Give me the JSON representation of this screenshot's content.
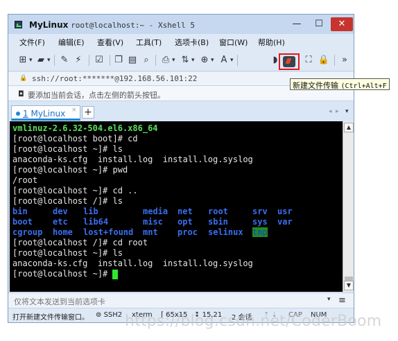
{
  "window": {
    "title_app": "MyLinux",
    "title_rest": "root@localhost:~ - Xshell 5",
    "min_glyph": "—",
    "max_glyph": "☐",
    "close_glyph": "✕"
  },
  "menu": [
    "文件(F)",
    "编辑(E)",
    "查看(V)",
    "工具(T)",
    "选项卡(B)",
    "窗口(W)",
    "帮助(H)"
  ],
  "toolbar": {
    "tooltip_label": "新建文件传输",
    "tooltip_shortcut": "(Ctrl+Alt+F",
    "overflow_glyph": "»"
  },
  "address": {
    "text": "ssh://root:*******@192.168.56.101:22"
  },
  "hint": {
    "text": "要添加当前会话，点击左侧的箭头按钮。"
  },
  "tab": {
    "number": "1",
    "label": "MyLinux",
    "close_glyph": "×",
    "add_glyph": "+"
  },
  "terminal": {
    "lines": [
      "vmlinuz-2.6.32-504.el6.x86_64",
      "[root@localhost boot]# cd",
      "[root@localhost ~]# ls",
      "anaconda-ks.cfg  install.log  install.log.syslog",
      "[root@localhost ~]# pwd",
      "/root",
      "[root@localhost ~]# cd ..",
      "[root@localhost /]# ls",
      "",
      "",
      "",
      "[root@localhost /]# cd root",
      "[root@localhost ~]# ls",
      "anaconda-ks.cfg  install.log  install.log.syslog",
      "[root@localhost ~]# "
    ],
    "ls_rows": [
      [
        "bin",
        "dev",
        "lib",
        "media",
        "net",
        "root",
        "srv",
        "usr"
      ],
      [
        "boot",
        "etc",
        "lib64",
        "misc",
        "opt",
        "sbin",
        "sys",
        "var"
      ],
      [
        "cgroup",
        "home",
        "lost+found",
        "mnt",
        "proc",
        "selinux",
        "tmp",
        ""
      ]
    ]
  },
  "sendbar": {
    "placeholder": "仅将文本发送到当前选项卡"
  },
  "status": {
    "left": "打开新建文件传输窗口。",
    "protocol": "SSH2",
    "term": "xterm",
    "size": "65x15",
    "pos": "15,21",
    "sessions": "2 会话",
    "cap": "CAP",
    "num": "NUM"
  },
  "watermark": "https://blog.csdn.net/CoderBoom",
  "colors": {
    "terminal_bg": "#000000",
    "dir_blue": "#3b6ff0",
    "green": "#5be35b",
    "highlight_red": "#e01818"
  }
}
